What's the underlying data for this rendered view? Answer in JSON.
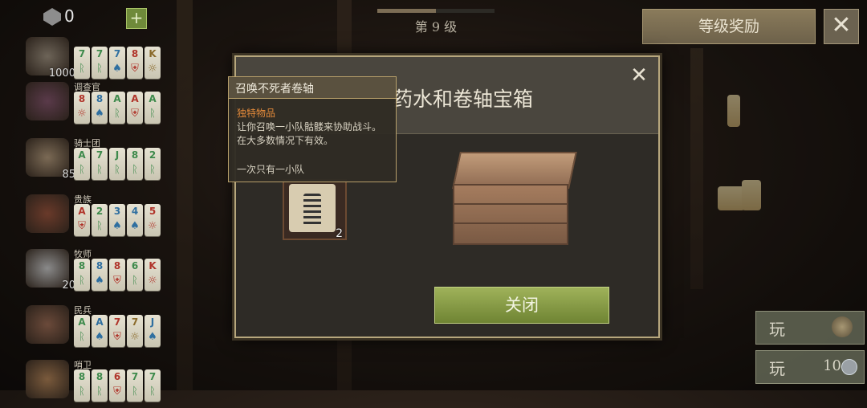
{
  "top_bar": {
    "gem_count": "0",
    "add_label": "+",
    "level_text": "第 9 级",
    "level_progress": 0.5,
    "reward_button": "等级奖励",
    "close_label": "✕"
  },
  "sidebar": {
    "rows": [
      {
        "title": "",
        "count": "1000",
        "tiles": [
          {
            "top": "7",
            "sym": "ᚱ",
            "color": "#3e8a4c"
          },
          {
            "top": "7",
            "sym": "ᚱ",
            "color": "#3e8a4c"
          },
          {
            "top": "7",
            "sym": "♠",
            "color": "#2f6fa0"
          },
          {
            "top": "8",
            "sym": "⛨",
            "color": "#b0342a"
          },
          {
            "top": "K",
            "sym": "☼",
            "color": "#8a6a2a"
          }
        ]
      },
      {
        "title": "调查官",
        "count": "",
        "tiles": [
          {
            "top": "8",
            "sym": "☼",
            "color": "#b0342a"
          },
          {
            "top": "8",
            "sym": "♠",
            "color": "#2f6fa0"
          },
          {
            "top": "A",
            "sym": "ᚱ",
            "color": "#3e8a4c"
          },
          {
            "top": "A",
            "sym": "⛨",
            "color": "#b0342a"
          },
          {
            "top": "A",
            "sym": "ᚱ",
            "color": "#3e8a4c"
          }
        ]
      },
      {
        "title": "骑士团",
        "count": "85",
        "tiles": [
          {
            "top": "A",
            "sym": "ᚱ",
            "color": "#3e8a4c"
          },
          {
            "top": "7",
            "sym": "ᚱ",
            "color": "#3e8a4c"
          },
          {
            "top": "J",
            "sym": "ᚱ",
            "color": "#3e8a4c"
          },
          {
            "top": "8",
            "sym": "ᚱ",
            "color": "#3e8a4c"
          },
          {
            "top": "2",
            "sym": "ᚱ",
            "color": "#3e8a4c"
          }
        ]
      },
      {
        "title": "贵族",
        "count": "",
        "tiles": [
          {
            "top": "A",
            "sym": "⛨",
            "color": "#b0342a"
          },
          {
            "top": "2",
            "sym": "ᚱ",
            "color": "#3e8a4c"
          },
          {
            "top": "3",
            "sym": "♠",
            "color": "#2f6fa0"
          },
          {
            "top": "4",
            "sym": "♠",
            "color": "#2f6fa0"
          },
          {
            "top": "5",
            "sym": "☼",
            "color": "#b0342a"
          }
        ]
      },
      {
        "title": "牧师",
        "count": "20",
        "tiles": [
          {
            "top": "8",
            "sym": "ᚱ",
            "color": "#3e8a4c"
          },
          {
            "top": "8",
            "sym": "♠",
            "color": "#2f6fa0"
          },
          {
            "top": "8",
            "sym": "⛨",
            "color": "#b0342a"
          },
          {
            "top": "6",
            "sym": "ᚱ",
            "color": "#3e8a4c"
          },
          {
            "top": "K",
            "sym": "☼",
            "color": "#b0342a"
          }
        ]
      },
      {
        "title": "民兵",
        "count": "",
        "tiles": [
          {
            "top": "A",
            "sym": "ᚱ",
            "color": "#3e8a4c"
          },
          {
            "top": "A",
            "sym": "♠",
            "color": "#2f6fa0"
          },
          {
            "top": "7",
            "sym": "⛨",
            "color": "#b0342a"
          },
          {
            "top": "7",
            "sym": "☼",
            "color": "#8a6a2a"
          },
          {
            "top": "J",
            "sym": "♠",
            "color": "#2f6fa0"
          }
        ]
      },
      {
        "title": "哨卫",
        "count": "",
        "tiles": [
          {
            "top": "8",
            "sym": "ᚱ",
            "color": "#3e8a4c"
          },
          {
            "top": "8",
            "sym": "ᚱ",
            "color": "#3e8a4c"
          },
          {
            "top": "6",
            "sym": "⛨",
            "color": "#b0342a"
          },
          {
            "top": "7",
            "sym": "ᚱ",
            "color": "#3e8a4c"
          },
          {
            "top": "7",
            "sym": "ᚱ",
            "color": "#3e8a4c"
          }
        ]
      }
    ]
  },
  "play_buttons": [
    {
      "label": "玩",
      "cost": "",
      "icon": "helmet-icon"
    },
    {
      "label": "玩",
      "cost": "10",
      "icon": "coin-icon"
    }
  ],
  "modal": {
    "title": "药水和卷轴宝箱",
    "close_x": "✕",
    "item_count": "2",
    "close_button": "关闭"
  },
  "tooltip": {
    "title": "召唤不死者卷轴",
    "unique": "独特物品",
    "description": "让你召唤一小队骷髅来协助战斗。在大多数情况下有效。",
    "limit": "一次只有一小队"
  }
}
